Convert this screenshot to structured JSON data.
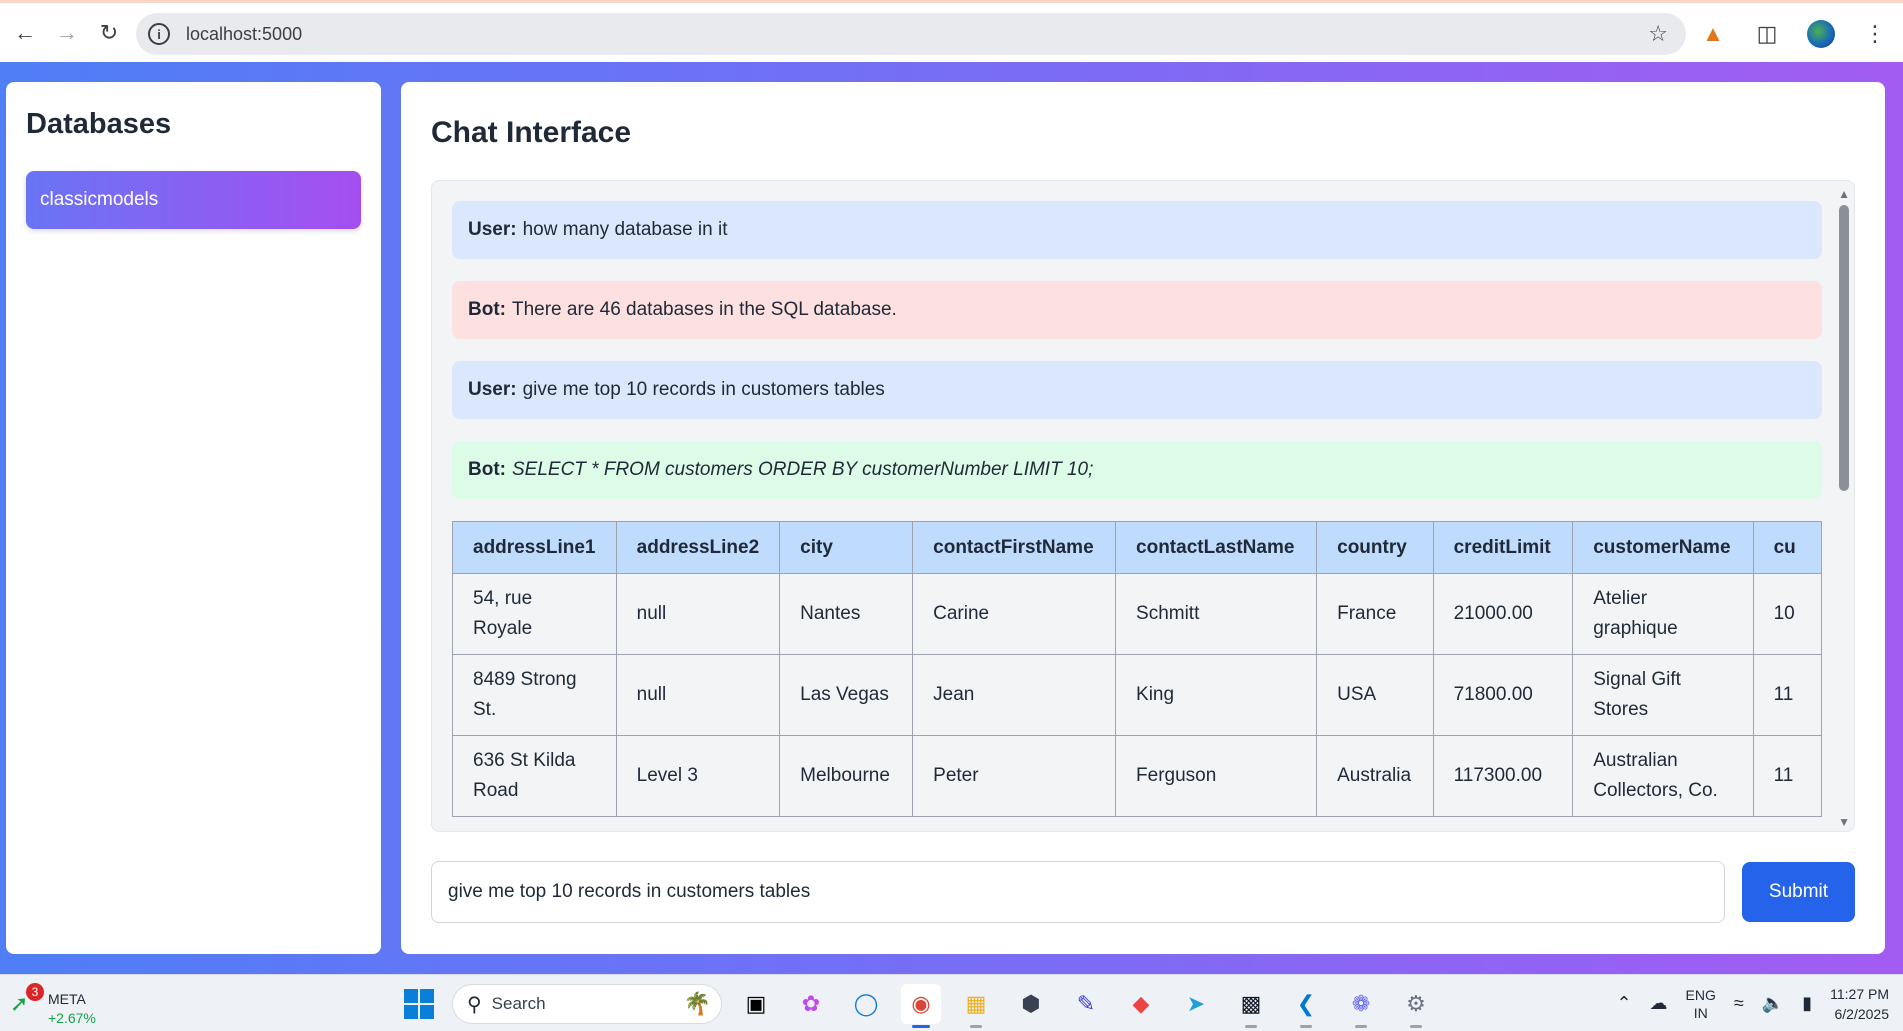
{
  "browser": {
    "url": "localhost:5000"
  },
  "sidebar": {
    "title": "Databases",
    "items": [
      {
        "label": "classicmodels"
      }
    ]
  },
  "chat": {
    "title": "Chat Interface",
    "messages": [
      {
        "speaker": "User:",
        "text": "how many database in it"
      },
      {
        "speaker": "Bot:",
        "text": "There are 46 databases in the SQL database."
      },
      {
        "speaker": "User:",
        "text": "give me top 10 records in customers tables"
      },
      {
        "speaker": "Bot:",
        "text": "SELECT * FROM customers ORDER BY customerNumber LIMIT 10;"
      }
    ],
    "table": {
      "columns": [
        "addressLine1",
        "addressLine2",
        "city",
        "contactFirstName",
        "contactLastName",
        "country",
        "creditLimit",
        "customerName",
        "cu"
      ],
      "rows": [
        [
          "54, rue Royale",
          "null",
          "Nantes",
          "Carine",
          "Schmitt",
          "France",
          "21000.00",
          "Atelier graphique",
          "10"
        ],
        [
          "8489 Strong St.",
          "null",
          "Las Vegas",
          "Jean",
          "King",
          "USA",
          "71800.00",
          "Signal Gift Stores",
          "11"
        ],
        [
          "636 St Kilda Road",
          "Level 3",
          "Melbourne",
          "Peter",
          "Ferguson",
          "Australia",
          "117300.00",
          "Australian Collectors, Co.",
          "11"
        ]
      ]
    },
    "input_value": "give me top 10 records in customers tables",
    "submit_label": "Submit"
  },
  "taskbar": {
    "stock": {
      "name": "META",
      "change": "+2.67%",
      "badge": "3"
    },
    "search_label": "Search",
    "lang_1": "ENG",
    "lang_2": "IN",
    "time": "11:27 PM",
    "date": "6/2/2025"
  },
  "colors": {
    "accent_blue": "#2563eb",
    "gradient_start": "#4f7ef7",
    "gradient_end": "#a35cf2",
    "user_bubble": "#dbe7fd",
    "bot_error_bubble": "#fde0e0",
    "bot_sql_bubble": "#dcfce7",
    "table_header": "#bfdbfe"
  }
}
